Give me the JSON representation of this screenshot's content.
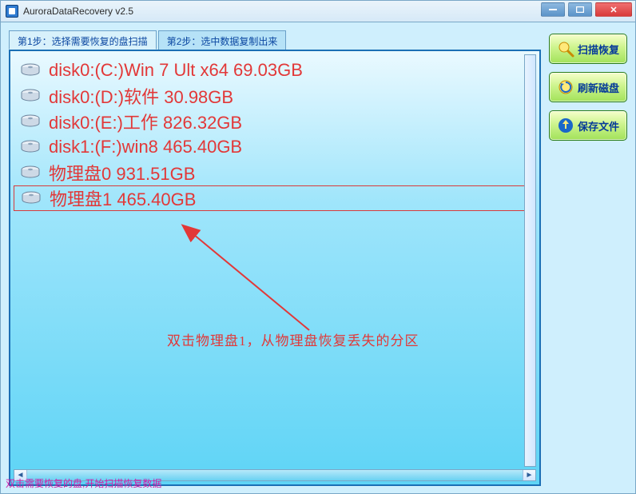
{
  "window": {
    "title": "AuroraDataRecovery v2.5"
  },
  "tabs": {
    "step1": "第1步：选择需要恢复的盘扫描",
    "step2": "第2步：选中数据复制出来"
  },
  "disks": [
    {
      "label": "disk0:(C:)Win 7 Ult x64 69.03GB",
      "selected": false
    },
    {
      "label": "disk0:(D:)软件 30.98GB",
      "selected": false
    },
    {
      "label": "disk0:(E:)工作 826.32GB",
      "selected": false
    },
    {
      "label": "disk1:(F:)win8 465.40GB",
      "selected": false
    },
    {
      "label": "物理盘0 931.51GB",
      "selected": false
    },
    {
      "label": "物理盘1 465.40GB",
      "selected": true
    }
  ],
  "annotation": "双击物理盘1，从物理盘恢复丢失的分区",
  "buttons": {
    "scan": "扫描恢复",
    "refresh": "刷新磁盘",
    "save": "保存文件"
  },
  "status": "双击需要恢复的盘,开始扫描恢复数据",
  "colors": {
    "accent_red": "#e23838",
    "button_green": "#a2e25a",
    "panel_blue": "#5ed4f6"
  }
}
